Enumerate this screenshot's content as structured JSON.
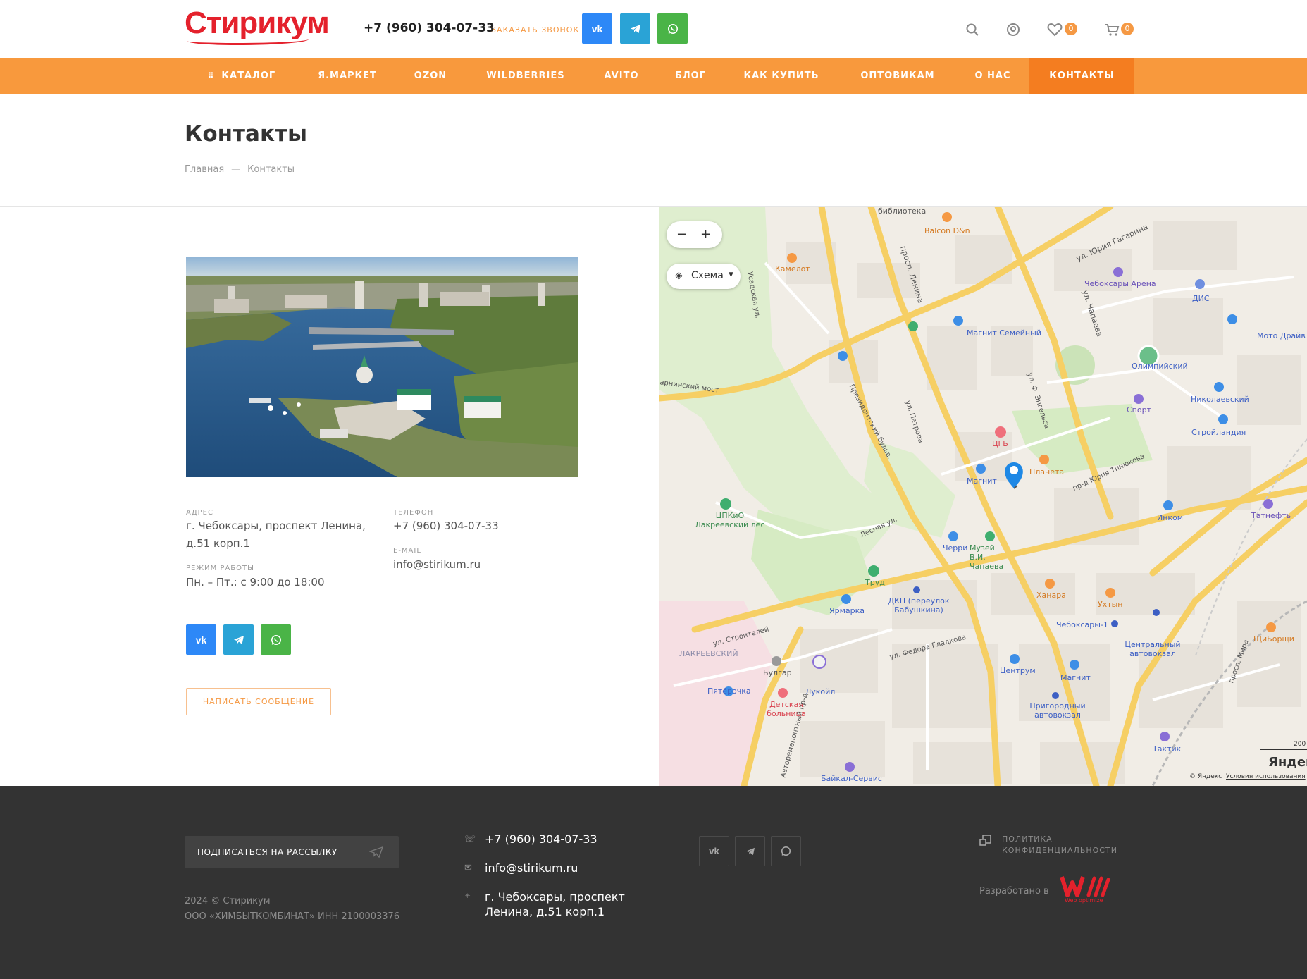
{
  "header": {
    "logo": "Стирикум",
    "phone": "+7 (960) 304-07-33",
    "callback": "ЗАКАЗАТЬ ЗВОНОК",
    "social": {
      "vk": "vk",
      "tg": "telegram-icon",
      "wa": "whatsapp-icon"
    },
    "favorites_count": "0",
    "cart_count": "0"
  },
  "nav": {
    "items": [
      "КАТАЛОГ",
      "Я.МАРКЕТ",
      "OZON",
      "WILDBERRIES",
      "AVITO",
      "БЛОГ",
      "КАК КУПИТЬ",
      "ОПТОВИКАМ",
      "О НАС",
      "КОНТАКТЫ"
    ],
    "active": "КОНТАКТЫ"
  },
  "page": {
    "title": "Контакты",
    "breadcrumb": [
      "Главная",
      "Контакты"
    ]
  },
  "contacts": {
    "address_label": "АДРЕС",
    "address": "г. Чебоксары, проспект Ленина, д.51 корп.1",
    "phone_label": "ТЕЛЕФОН",
    "phone": "+7 (960) 304-07-33",
    "email_label": "E-MAIL",
    "email": "info@stirikum.ru",
    "hours_label": "РЕЖИМ РАБОТЫ",
    "hours": "Пн. – Пт.: с 9:00 до 18:00",
    "write_button": "НАПИСАТЬ СООБЩЕНИЕ"
  },
  "map": {
    "zoom_out": "−",
    "zoom_in": "+",
    "layer": "Схема",
    "labels": [
      "библиотека",
      "Balcon D&n",
      "Камелот",
      "ул. Юрия Гагарина",
      "просп. Ленина",
      "Чебоксары Арена",
      "ДИС",
      "Магнит Семейный",
      "ул. Чапаева",
      "Мото Драйв",
      "Олимпийский",
      "Николаевский",
      "Спорт",
      "Стройландия",
      "ЦГБ",
      "Планета",
      "Магнит",
      "ул. Ф. Энгельса",
      "пр-д Юрия Тинюкова",
      "ЦПКиО Лакреевский лес",
      "Инком",
      "Татнефть",
      "Черри",
      "Музей В.И. Чапаева",
      "Труд",
      "Лесная ул.",
      "Президентский бульв.",
      "ул. Петрова",
      "Ханара",
      "Ухтын",
      "ДКП (переулок Бабушкина)",
      "Ярмарка",
      "Чебоксары-1",
      "Центральный автовокзал",
      "ЩиБорщи",
      "ул. Строителей",
      "ЛАКРЕЕВСКИЙ",
      "Булгар",
      "ул. Федора Гладкова",
      "Центрум",
      "Магнит",
      "Пятёрочка",
      "Лукойл",
      "Детская больница",
      "Пригородный автовокзал",
      "Тактик",
      "Байкал-Сервис",
      "Автоременонтный пр-д",
      "просп. Мира",
      "арнинский мост",
      "Усадская ул.",
      "Яндекс",
      "© Яндекс",
      "Условия использования",
      "200"
    ],
    "accent": "#1e88e5"
  },
  "footer": {
    "subscribe": "ПОДПИСАТЬСЯ НА РАССЫЛКУ",
    "copyright": "2024 © Стирикум",
    "company": "ООО «ХИМБЫТКОМБИНАТ» ИНН 2100003376",
    "phone": "+7 (960) 304-07-33",
    "email": "info@stirikum.ru",
    "address": "г. Чебоксары, проспект Ленина, д.51 корп.1",
    "policy": "ПОЛИТИКА КОНФИДЕНЦИАЛЬНОСТИ",
    "developed": "Разработано в",
    "dev_logo": "Web optimize"
  },
  "colors": {
    "brand": "#e4212c",
    "accent": "#f8993d",
    "nav_active": "#f47d20",
    "vk": "#2d88f7",
    "telegram": "#2aa3d6",
    "whatsapp": "#4ab447",
    "footer_bg": "#333333"
  }
}
